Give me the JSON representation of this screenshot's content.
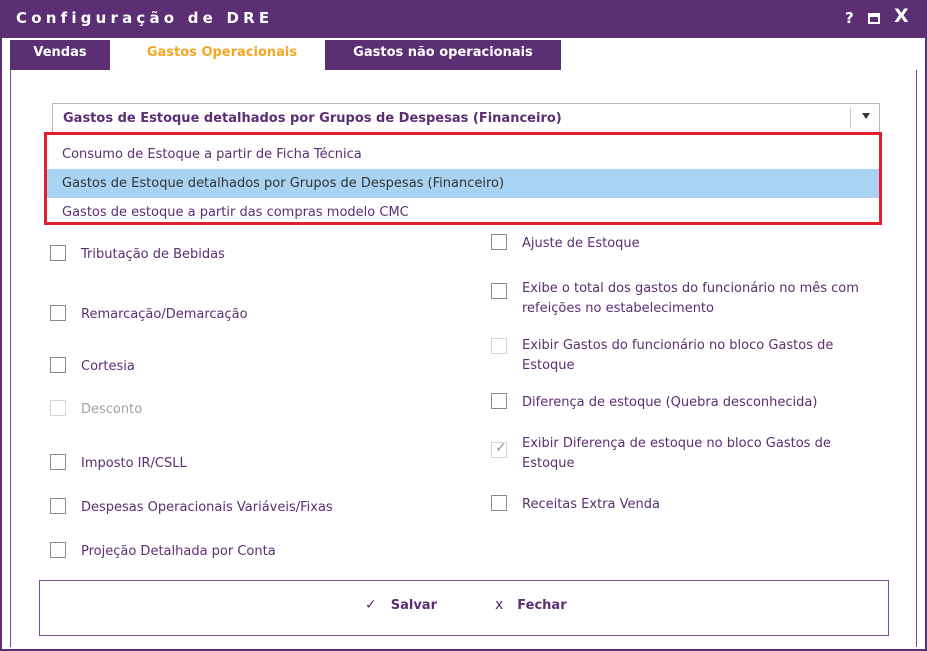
{
  "window": {
    "title": "Configuração de DRE",
    "help_label": "?",
    "close_label": "X"
  },
  "tabs": [
    {
      "label": "Vendas",
      "active": false
    },
    {
      "label": "Gastos Operacionais",
      "active": true
    },
    {
      "label": "Gastos não operacionais",
      "active": false
    }
  ],
  "select": {
    "value": "Gastos de Estoque detalhados por Grupos de Despesas (Financeiro)",
    "options": [
      {
        "label": "Consumo de Estoque a partir de Ficha Técnica",
        "highlighted": false
      },
      {
        "label": "Gastos de Estoque detalhados por Grupos de Despesas (Financeiro)",
        "highlighted": true
      },
      {
        "label": "Gastos de estoque a partir das compras modelo CMC",
        "highlighted": false
      }
    ]
  },
  "left_checkboxes": [
    {
      "label": "Tributação de Bebidas",
      "checked": false,
      "disabled": false
    },
    {
      "label": "Remarcação/Demarcação",
      "checked": false,
      "disabled": false
    },
    {
      "label": "Cortesia",
      "checked": false,
      "disabled": false
    },
    {
      "label": "Desconto",
      "checked": false,
      "disabled": true
    },
    {
      "label": "Imposto IR/CSLL",
      "checked": false,
      "disabled": false
    },
    {
      "label": "Despesas Operacionais Variáveis/Fixas",
      "checked": false,
      "disabled": false
    },
    {
      "label": "Projeção Detalhada por Conta",
      "checked": false,
      "disabled": false
    }
  ],
  "right_checkboxes": [
    {
      "label": "Ajuste de Estoque",
      "checked": false,
      "disabled": false
    },
    {
      "label": "Exibe o total dos gastos do funcionário no mês com refeições no estabelecimento",
      "checked": false,
      "disabled": false
    },
    {
      "label": "Exibir Gastos do funcionário no bloco Gastos de Estoque",
      "checked": false,
      "disabled": true
    },
    {
      "label": "Diferença de estoque (Quebra desconhecida)",
      "checked": false,
      "disabled": false
    },
    {
      "label": "Exibir Diferença de estoque no bloco Gastos de Estoque",
      "checked": true,
      "disabled": true
    },
    {
      "label": "Receitas Extra Venda",
      "checked": false,
      "disabled": false
    }
  ],
  "footer": {
    "save_label": "Salvar",
    "save_icon": "check-icon",
    "close_label": "Fechar",
    "close_icon": "x-icon"
  },
  "colors": {
    "brand": "#5c2e73",
    "active_tab_text": "#f5a623",
    "highlight": "#e0202f",
    "option_selected_bg": "#a8d3f2"
  }
}
